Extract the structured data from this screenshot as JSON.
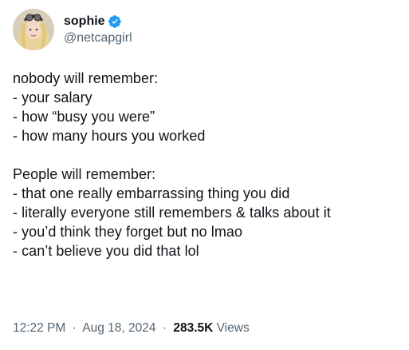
{
  "author": {
    "display_name": "sophie",
    "handle": "@netcapgirl",
    "verified_badge_icon": "verified-badge-icon",
    "badge_color": "#1d9bf0"
  },
  "tweet": {
    "paragraph_1": {
      "heading": "nobody will remember:",
      "items": [
        "- your salary",
        "- how “busy you were”",
        "- how many hours you worked"
      ]
    },
    "paragraph_2": {
      "heading": "People will remember:",
      "items": [
        "- that one really embarrassing thing you did",
        "- literally everyone still remembers & talks about it",
        "- you’d think they forget but no lmao",
        "- can’t believe you did that lol"
      ]
    }
  },
  "meta": {
    "time": "12:22 PM",
    "separator": "·",
    "date": "Aug 18, 2024",
    "views_count": "283.5K",
    "views_label": "Views"
  },
  "colors": {
    "text_primary": "#0f1419",
    "text_secondary": "#536471",
    "accent": "#1d9bf0"
  }
}
